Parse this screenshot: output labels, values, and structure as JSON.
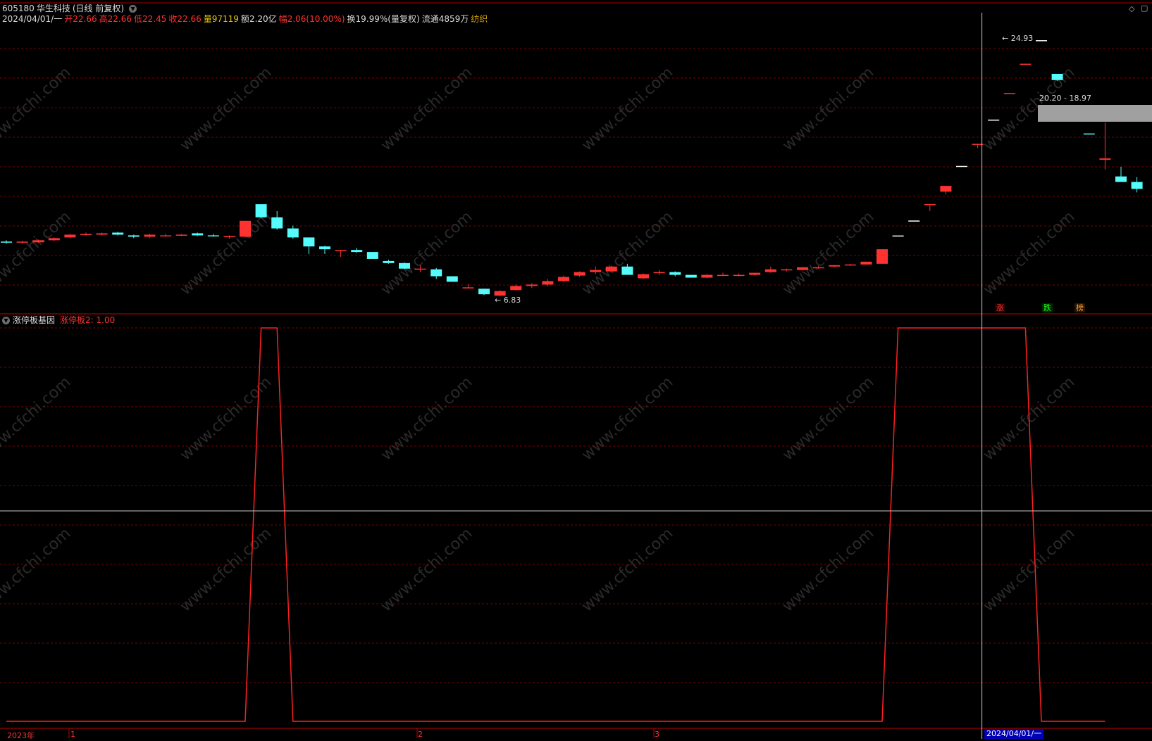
{
  "header": {
    "code": "605180",
    "name": "华生科技",
    "period": "(日线 前复权)",
    "date": "2024/04/01/一",
    "open_label": "开",
    "open": "22.66",
    "high_label": "高",
    "high": "22.66",
    "low_label": "低",
    "low": "22.45",
    "close_label": "收",
    "close": "22.66",
    "vol_label": "量",
    "vol": "97119",
    "amount_label": "额",
    "amount": "2.20亿",
    "range_label": "幅",
    "range": "2.06(10.00%)",
    "turnover_label": "换",
    "turnover": "19.99%(量复权)",
    "float_label": "流通",
    "float": "4859万",
    "industry": "纺织"
  },
  "price_panel": {
    "max_label": "24.93",
    "min_label": "6.83",
    "range_label": "20.20 - 18.97",
    "tags": [
      "涨",
      "跌",
      "榜"
    ]
  },
  "indicator_panel": {
    "name": "涨停板基因",
    "series_label": "涨停板2: 1.00"
  },
  "x_axis": {
    "labels": [
      "2023年",
      "1",
      "2",
      "3"
    ],
    "cursor_date": "2024/04/01/一"
  },
  "watermark": "www.cfchi.com",
  "colors": {
    "up": "#ff3232",
    "down": "#54fcfc",
    "grid": "#7a0000",
    "indicator": "#ff2020",
    "flat": "#ffffff"
  },
  "chart_data": [
    {
      "type": "candlestick",
      "title": "",
      "ylim": [
        6.0,
        26.0
      ],
      "candles": [
        {
          "o": 10.4,
          "h": 10.5,
          "l": 10.25,
          "c": 10.35
        },
        {
          "o": 10.35,
          "h": 10.45,
          "l": 10.25,
          "c": 10.4
        },
        {
          "o": 10.35,
          "h": 10.55,
          "l": 10.3,
          "c": 10.5
        },
        {
          "o": 10.5,
          "h": 10.7,
          "l": 10.45,
          "c": 10.65
        },
        {
          "o": 10.7,
          "h": 10.95,
          "l": 10.65,
          "c": 10.9
        },
        {
          "o": 10.9,
          "h": 11.05,
          "l": 10.85,
          "c": 10.95
        },
        {
          "o": 10.9,
          "h": 11.05,
          "l": 10.85,
          "c": 11.0
        },
        {
          "o": 11.05,
          "h": 11.1,
          "l": 10.85,
          "c": 10.9
        },
        {
          "o": 10.85,
          "h": 10.9,
          "l": 10.65,
          "c": 10.75
        },
        {
          "o": 10.75,
          "h": 10.95,
          "l": 10.65,
          "c": 10.9
        },
        {
          "o": 10.85,
          "h": 10.95,
          "l": 10.75,
          "c": 10.85
        },
        {
          "o": 10.85,
          "h": 10.95,
          "l": 10.8,
          "c": 10.9
        },
        {
          "o": 11.0,
          "h": 11.05,
          "l": 10.8,
          "c": 10.85
        },
        {
          "o": 10.85,
          "h": 10.95,
          "l": 10.75,
          "c": 10.8
        },
        {
          "o": 10.75,
          "h": 10.85,
          "l": 10.6,
          "c": 10.8
        },
        {
          "o": 10.75,
          "h": 11.9,
          "l": 10.7,
          "c": 11.9
        },
        {
          "o": 13.1,
          "h": 13.1,
          "l": 12.1,
          "c": 12.15
        },
        {
          "o": 12.15,
          "h": 12.6,
          "l": 11.25,
          "c": 11.35
        },
        {
          "o": 11.35,
          "h": 11.55,
          "l": 10.6,
          "c": 10.7
        },
        {
          "o": 10.7,
          "h": 10.7,
          "l": 9.5,
          "c": 10.05
        },
        {
          "o": 10.05,
          "h": 10.1,
          "l": 9.5,
          "c": 9.85
        },
        {
          "o": 9.8,
          "h": 9.8,
          "l": 9.3,
          "c": 9.8
        },
        {
          "o": 9.8,
          "h": 9.95,
          "l": 9.6,
          "c": 9.65
        },
        {
          "o": 9.65,
          "h": 9.65,
          "l": 9.15,
          "c": 9.15
        },
        {
          "o": 9.0,
          "h": 9.1,
          "l": 8.8,
          "c": 8.85
        },
        {
          "o": 8.85,
          "h": 8.9,
          "l": 8.4,
          "c": 8.45
        },
        {
          "o": 8.45,
          "h": 8.7,
          "l": 8.2,
          "c": 8.45
        },
        {
          "o": 8.4,
          "h": 8.5,
          "l": 7.7,
          "c": 7.9
        },
        {
          "o": 7.9,
          "h": 7.9,
          "l": 7.5,
          "c": 7.5
        },
        {
          "o": 7.1,
          "h": 7.35,
          "l": 7.05,
          "c": 7.1
        },
        {
          "o": 7.0,
          "h": 7.0,
          "l": 6.55,
          "c": 6.6
        },
        {
          "o": 6.5,
          "h": 6.9,
          "l": 6.5,
          "c": 6.83
        },
        {
          "o": 6.9,
          "h": 7.3,
          "l": 6.85,
          "c": 7.2
        },
        {
          "o": 7.2,
          "h": 7.4,
          "l": 7.05,
          "c": 7.3
        },
        {
          "o": 7.3,
          "h": 7.7,
          "l": 7.2,
          "c": 7.55
        },
        {
          "o": 7.55,
          "h": 7.95,
          "l": 7.5,
          "c": 7.85
        },
        {
          "o": 7.95,
          "h": 8.25,
          "l": 7.85,
          "c": 8.2
        },
        {
          "o": 8.2,
          "h": 8.6,
          "l": 8.05,
          "c": 8.35
        },
        {
          "o": 8.25,
          "h": 8.65,
          "l": 8.25,
          "c": 8.6
        },
        {
          "o": 8.6,
          "h": 8.8,
          "l": 8.05,
          "c": 8.0
        },
        {
          "o": 7.75,
          "h": 8.1,
          "l": 7.7,
          "c": 8.05
        },
        {
          "o": 8.15,
          "h": 8.35,
          "l": 8.0,
          "c": 8.2
        },
        {
          "o": 8.2,
          "h": 8.25,
          "l": 7.9,
          "c": 8.0
        },
        {
          "o": 8.0,
          "h": 8.0,
          "l": 7.8,
          "c": 7.8
        },
        {
          "o": 7.8,
          "h": 8.05,
          "l": 7.75,
          "c": 8.0
        },
        {
          "o": 7.95,
          "h": 8.15,
          "l": 7.95,
          "c": 8.0
        },
        {
          "o": 7.95,
          "h": 8.1,
          "l": 7.9,
          "c": 8.0
        },
        {
          "o": 8.0,
          "h": 8.15,
          "l": 7.95,
          "c": 8.15
        },
        {
          "o": 8.2,
          "h": 8.6,
          "l": 8.15,
          "c": 8.4
        },
        {
          "o": 8.35,
          "h": 8.45,
          "l": 8.25,
          "c": 8.4
        },
        {
          "o": 8.35,
          "h": 8.55,
          "l": 8.3,
          "c": 8.55
        },
        {
          "o": 8.55,
          "h": 8.65,
          "l": 8.45,
          "c": 8.55
        },
        {
          "o": 8.6,
          "h": 8.7,
          "l": 8.55,
          "c": 8.7
        },
        {
          "o": 8.7,
          "h": 8.8,
          "l": 8.65,
          "c": 8.75
        },
        {
          "o": 8.75,
          "h": 8.95,
          "l": 8.75,
          "c": 8.95
        },
        {
          "o": 8.8,
          "h": 9.85,
          "l": 8.8,
          "c": 9.85
        },
        {
          "o": 10.84,
          "h": 10.84,
          "l": 10.84,
          "c": 10.84
        },
        {
          "o": 11.92,
          "h": 11.92,
          "l": 11.92,
          "c": 11.92
        },
        {
          "o": 13.11,
          "h": 13.11,
          "l": 12.6,
          "c": 13.11
        },
        {
          "o": 14.0,
          "h": 14.42,
          "l": 13.8,
          "c": 14.42
        },
        {
          "o": 15.86,
          "h": 15.86,
          "l": 15.86,
          "c": 15.86
        },
        {
          "o": 17.45,
          "h": 17.45,
          "l": 17.15,
          "c": 17.45
        },
        {
          "o": 19.2,
          "h": 19.2,
          "l": 19.2,
          "c": 19.2
        },
        {
          "o": 21.1,
          "h": 21.12,
          "l": 21.05,
          "c": 21.12
        },
        {
          "o": 23.2,
          "h": 23.23,
          "l": 23.2,
          "c": 23.23
        },
        {
          "o": 24.93,
          "h": 24.93,
          "l": 24.93,
          "c": 24.93
        },
        {
          "o": 22.5,
          "h": 22.5,
          "l": 22.0,
          "c": 22.05
        },
        {
          "o": 20.2,
          "h": 20.2,
          "l": 20.15,
          "c": 20.2
        },
        {
          "o": 18.2,
          "h": 18.2,
          "l": 18.15,
          "c": 18.18
        },
        {
          "o": 16.3,
          "h": 18.97,
          "l": 15.6,
          "c": 16.4
        },
        {
          "o": 15.1,
          "h": 15.8,
          "l": 14.85,
          "c": 14.7
        },
        {
          "o": 14.7,
          "h": 15.05,
          "l": 13.95,
          "c": 14.2
        }
      ]
    },
    {
      "type": "line",
      "title": "涨停板基因",
      "series": [
        {
          "name": "涨停板2",
          "values": [
            0,
            0,
            0,
            0,
            0,
            0,
            0,
            0,
            0,
            0,
            0,
            0,
            0,
            0,
            0,
            0,
            1,
            1,
            0,
            0,
            0,
            0,
            0,
            0,
            0,
            0,
            0,
            0,
            0,
            0,
            0,
            0,
            0,
            0,
            0,
            0,
            0,
            0,
            0,
            0,
            0,
            0,
            0,
            0,
            0,
            0,
            0,
            0,
            0,
            0,
            0,
            0,
            0,
            0,
            0,
            0,
            1,
            1,
            1,
            1,
            1,
            1,
            1,
            1,
            1,
            0,
            0,
            0,
            0,
            0
          ]
        }
      ],
      "ylim": [
        0,
        1
      ]
    }
  ]
}
